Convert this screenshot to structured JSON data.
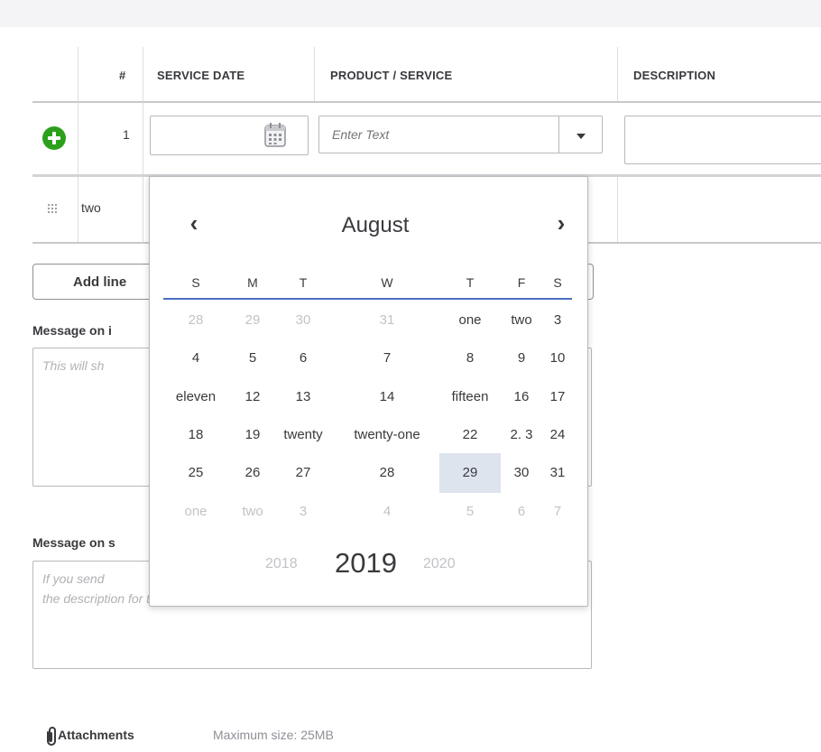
{
  "table": {
    "columns": [
      "#",
      "SERVICE DATE",
      "PRODUCT / SERVICE",
      "DESCRIPTION"
    ],
    "rows": [
      {
        "number": "1",
        "product_placeholder": "Enter Text"
      },
      {
        "number": "two"
      }
    ]
  },
  "actions": {
    "add_lines": "Add line"
  },
  "message_invoice": {
    "label": "Message on i",
    "placeholder": "This will sh"
  },
  "message_statement": {
    "label": "Message on s",
    "placeholder_line1": "If you send",
    "placeholder_line2": "the description for this invoice."
  },
  "attachments": {
    "label": "Attachments",
    "max_size": "Maximum size: 25MB"
  },
  "calendar": {
    "month": "August",
    "prev_glyph": "‹",
    "next_glyph": "›",
    "weekdays": [
      "S",
      "M",
      "T",
      "W",
      "T",
      "F",
      "S"
    ],
    "weeks": [
      [
        "28",
        "29",
        "30",
        "31",
        "one",
        "two",
        "3"
      ],
      [
        "4",
        "5",
        "6",
        "7",
        "8",
        "9",
        "10"
      ],
      [
        "eleven",
        "12",
        "13",
        "14",
        "fifteen",
        "16",
        "17"
      ],
      [
        "18",
        "19",
        "twenty",
        "twenty-one",
        "22",
        "2. 3",
        "24"
      ],
      [
        "25",
        "26",
        "27",
        "28",
        "29",
        "30",
        "31"
      ],
      [
        "one",
        "two",
        "3",
        "4",
        "5",
        "6",
        "7"
      ]
    ],
    "muted_days": [
      [
        0,
        0
      ],
      [
        0,
        1
      ],
      [
        0,
        2
      ],
      [
        0,
        3
      ],
      [
        5,
        0
      ],
      [
        5,
        1
      ],
      [
        5,
        2
      ],
      [
        5,
        3
      ],
      [
        5,
        4
      ],
      [
        5,
        5
      ],
      [
        5,
        6
      ]
    ],
    "selected_day": [
      4,
      4
    ],
    "years": {
      "previous": "2018",
      "current": "2019",
      "next": "2020"
    }
  },
  "icons": {
    "add_row": "plus-circle-icon",
    "drag_handle": "drag-handle-icon",
    "calendar": "calendar-icon",
    "dropdown": "chevron-down-icon",
    "attachment": "paperclip-icon"
  },
  "colors": {
    "accent_green": "#2ca01c",
    "weekday_underline": "#4a6fc0",
    "selected_day_bg": "#dde4ee"
  }
}
